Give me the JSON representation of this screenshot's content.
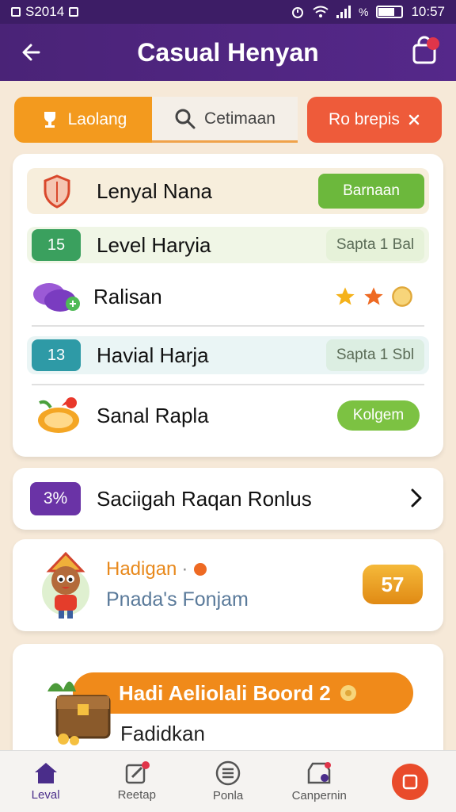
{
  "status_bar": {
    "left_text": "S2014",
    "time": "10:57",
    "percent_glyph": "%"
  },
  "header": {
    "title": "Casual Henyan"
  },
  "tabs": [
    {
      "label": "Laolang",
      "icon": "trophy-icon"
    },
    {
      "label": "Cetimaan",
      "icon": "search-icon"
    },
    {
      "label": "Ro brepis",
      "icon": "close-icon"
    }
  ],
  "list": {
    "rows": [
      {
        "label": "Lenyal Nana",
        "button": "Barnaan",
        "icon": "shield-icon"
      },
      {
        "badge": "15",
        "label": "Level Haryia",
        "pill": "Sapta 1 Bal"
      },
      {
        "label": "Ralisan",
        "icon": "gems-icon"
      },
      {
        "badge": "13",
        "label": "Havial Harja",
        "pill": "Sapta 1 Sbl"
      },
      {
        "label": "Sanal Rapla",
        "button": "Kolgem",
        "icon": "fruit-icon"
      }
    ]
  },
  "bonus": {
    "badge": "3%",
    "label": "Saciigah Raqan Ronlus"
  },
  "mascot_card": {
    "title": "Hadigan",
    "subtitle": "Pnada's Fonjam",
    "coin_value": "57"
  },
  "chest_card": {
    "banner": "Hadi Aeliolali Boord 2",
    "subtitle": "Fadidkan"
  },
  "nav": [
    {
      "label": "Leval",
      "icon": "home-icon"
    },
    {
      "label": "Reetap",
      "icon": "edit-icon"
    },
    {
      "label": "Ponla",
      "icon": "menu-icon"
    },
    {
      "label": "Canpernin",
      "icon": "shop-icon"
    },
    {
      "label": "",
      "icon": "stop-icon"
    }
  ],
  "colors": {
    "header": "#4a2377",
    "orange": "#f39a1e",
    "red": "#ee5b3a",
    "green": "#6cb83c",
    "purple": "#6a33a6"
  }
}
